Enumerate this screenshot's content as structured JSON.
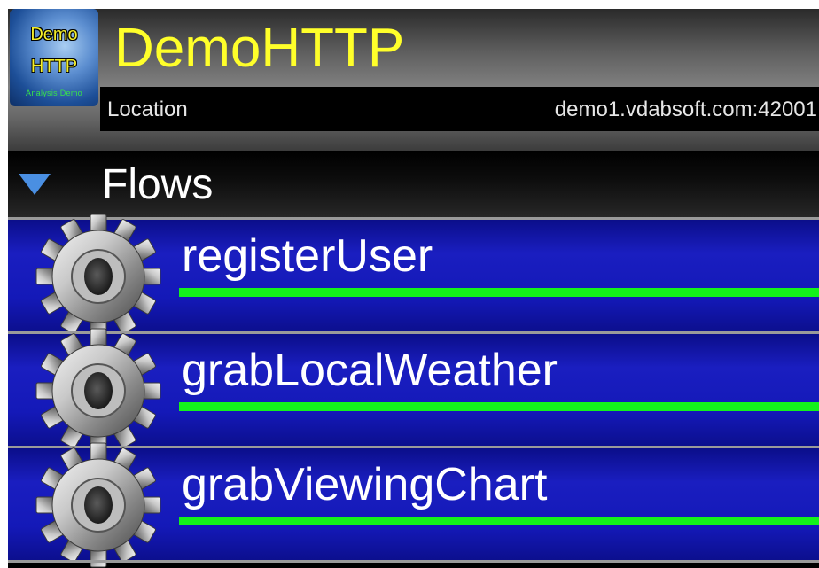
{
  "app": {
    "title": "DemoHTTP",
    "icon": {
      "line1": "Demo",
      "line2": "HTTP",
      "line3": "Analysis Demo"
    },
    "location_label": "Location",
    "location_value": "demo1.vdabsoft.com:42001"
  },
  "section": {
    "label": "Flows",
    "expand_icon": "triangle-down-icon"
  },
  "flows": [
    {
      "name": "registerUser",
      "icon": "gear-icon",
      "progress": 1.0
    },
    {
      "name": "grabLocalWeather",
      "icon": "gear-icon",
      "progress": 1.0
    },
    {
      "name": "grabViewingChart",
      "icon": "gear-icon",
      "progress": 1.0
    }
  ],
  "colors": {
    "title": "#ffff2a",
    "row_blue": "#1419b8",
    "progress_green": "#14f21b",
    "arrow_blue": "#4a8fe2"
  }
}
